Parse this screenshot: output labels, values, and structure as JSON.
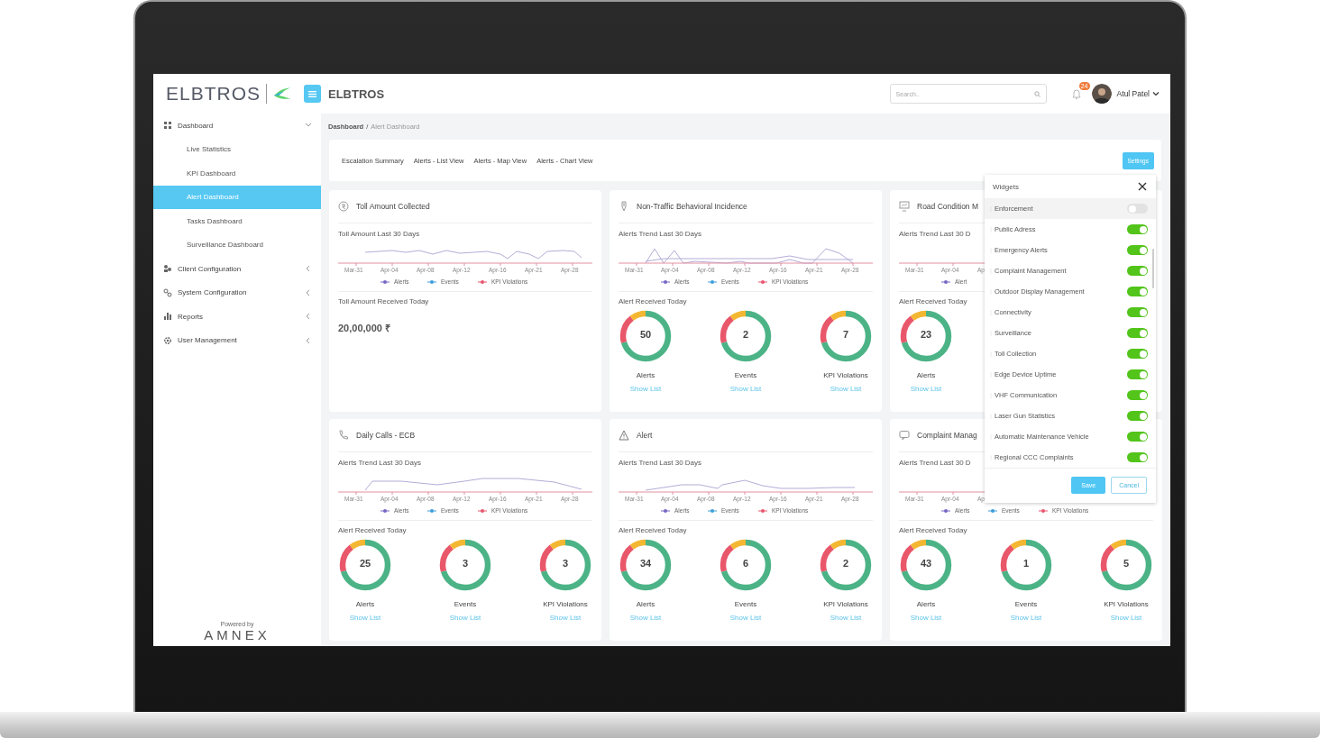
{
  "app": {
    "logo": "ELBTROS",
    "title": "ELBTROS"
  },
  "search": {
    "placeholder": "Search.."
  },
  "notifications": {
    "count": "24"
  },
  "user": {
    "name": "Atul Patel"
  },
  "sidebar": {
    "items": [
      {
        "label": "Dashboard",
        "expanded": true,
        "children": [
          {
            "label": "Live Statistics",
            "selected": false
          },
          {
            "label": "KPI Dashboard",
            "selected": false
          },
          {
            "label": "Alert Dashboard",
            "selected": true
          },
          {
            "label": "Tasks Dashboard",
            "selected": false
          },
          {
            "label": "Surveillance Dashboard",
            "selected": false
          }
        ]
      },
      {
        "label": "Client Configuration",
        "expanded": false
      },
      {
        "label": "System Configuration",
        "expanded": false
      },
      {
        "label": "Reports",
        "expanded": false
      },
      {
        "label": "User Management",
        "expanded": false
      }
    ]
  },
  "footer": {
    "caption": "Powered by",
    "brand": "AMNEX"
  },
  "breadcrumb": {
    "items": [
      "Dashboard",
      "Alert Dashboard"
    ],
    "separator": "/"
  },
  "tabs": [
    "Escalation Summary",
    "Alerts - List View",
    "Alerts - Map View",
    "Alerts - Chart View"
  ],
  "settings_button": "Settings",
  "cards": [
    {
      "title": "Toll Amount Collected",
      "trend_title": "Toll Amount Last 30 Days",
      "x_labels": [
        "Mar-31",
        "Apr-04",
        "Apr-08",
        "Apr-12",
        "Apr-16",
        "Apr-21",
        "Apr-28"
      ],
      "legend": [
        {
          "label": "Alerts",
          "color": "#7468c4"
        },
        {
          "label": "Events",
          "color": "#3d9fdc"
        },
        {
          "label": "KPI Violations",
          "color": "#e8566e"
        }
      ],
      "summary_title": "Toll Amount Received Today",
      "amount": "20,00,000 ₹"
    },
    {
      "title": "Non-Traffic Behavioral Incidence",
      "trend_title": "Alerts Trend Last 30 Days",
      "x_labels": [
        "Mar-31",
        "Apr-04",
        "Apr-08",
        "Apr-12",
        "Apr-16",
        "Apr-21",
        "Apr-28"
      ],
      "legend": [
        {
          "label": "Alerts",
          "color": "#7468c4"
        },
        {
          "label": "Events",
          "color": "#3d9fdc"
        },
        {
          "label": "KPI Violations",
          "color": "#e8566e"
        }
      ],
      "summary_title": "Alert Received Today",
      "counts": [
        {
          "value": "50",
          "label": "Alerts",
          "link": "Show List"
        },
        {
          "value": "2",
          "label": "Events",
          "link": "Show List"
        },
        {
          "value": "7",
          "label": "KPI Violations",
          "link": "Show List"
        }
      ]
    },
    {
      "title": "Road Condition M",
      "trend_title": "Alerts Trend Last 30 D",
      "x_labels": [
        "Mar-31",
        "Apr-04",
        "Ap"
      ],
      "legend": [
        {
          "label": "Alert",
          "color": "#7468c4"
        }
      ],
      "summary_title": "Alert Received Today",
      "counts": [
        {
          "value": "23",
          "label": "Alerts",
          "link": "Show List"
        }
      ]
    },
    {
      "title": "Daily Calls - ECB",
      "trend_title": "Alerts Trend Last 30 Days",
      "x_labels": [
        "Mar-31",
        "Apr-04",
        "Apr-08",
        "Apr-12",
        "Apr-16",
        "Apr-21",
        "Apr-28"
      ],
      "legend": [
        {
          "label": "Alerts",
          "color": "#7468c4"
        },
        {
          "label": "Events",
          "color": "#3d9fdc"
        },
        {
          "label": "KPI Violations",
          "color": "#e8566e"
        }
      ],
      "summary_title": "Alert Received Today",
      "counts": [
        {
          "value": "25",
          "label": "Alerts",
          "link": "Show List"
        },
        {
          "value": "3",
          "label": "Events",
          "link": "Show List"
        },
        {
          "value": "3",
          "label": "KPI Violations",
          "link": "Show List"
        }
      ]
    },
    {
      "title": "Alert",
      "trend_title": "Alerts Trend Last 30 Days",
      "x_labels": [
        "Mar-31",
        "Apr-04",
        "Apr-08",
        "Apr-12",
        "Apr-16",
        "Apr-21",
        "Apr-28"
      ],
      "legend": [
        {
          "label": "Alerts",
          "color": "#7468c4"
        },
        {
          "label": "Events",
          "color": "#3d9fdc"
        },
        {
          "label": "KPI Violations",
          "color": "#e8566e"
        }
      ],
      "summary_title": "Alert Received Today",
      "counts": [
        {
          "value": "34",
          "label": "Alerts",
          "link": "Show List"
        },
        {
          "value": "6",
          "label": "Events",
          "link": "Show List"
        },
        {
          "value": "2",
          "label": "KPI Violations",
          "link": "Show List"
        }
      ]
    },
    {
      "title": "Complaint Manag",
      "trend_title": "Alerts Trend Last 30 D",
      "x_labels": [
        "Mar-31",
        "Apr-04",
        "Ap"
      ],
      "legend": [
        {
          "label": "Alerts",
          "color": "#7468c4"
        },
        {
          "label": "Events",
          "color": "#3d9fdc"
        },
        {
          "label": "KPI Violations",
          "color": "#e8566e"
        }
      ],
      "summary_title": "Alert Received Today",
      "counts": [
        {
          "value": "43",
          "label": "Alerts",
          "link": "Show List"
        },
        {
          "value": "1",
          "label": "Events",
          "link": "Show List"
        },
        {
          "value": "5",
          "label": "KPI Violations",
          "link": "Show List"
        }
      ]
    }
  ],
  "widgets_panel": {
    "title": "Widgets",
    "items": [
      {
        "label": "Enforcement",
        "on": false,
        "highlighted": true
      },
      {
        "label": "Public Adress",
        "on": true,
        "highlighted": false
      },
      {
        "label": "Emergency Alerts",
        "on": true,
        "highlighted": false
      },
      {
        "label": "Complaint Management",
        "on": true,
        "highlighted": false
      },
      {
        "label": "Outdoor Display Management",
        "on": true,
        "highlighted": false
      },
      {
        "label": "Connectivity",
        "on": true,
        "highlighted": false
      },
      {
        "label": "Surveillance",
        "on": true,
        "highlighted": false
      },
      {
        "label": "Toll Collection",
        "on": true,
        "highlighted": false
      },
      {
        "label": "Edge Device Uptime",
        "on": true,
        "highlighted": false
      },
      {
        "label": "VHF Communication",
        "on": true,
        "highlighted": false
      },
      {
        "label": "Laser Gun Statistics",
        "on": true,
        "highlighted": false
      },
      {
        "label": "Automatic Maintenance Vehicle",
        "on": true,
        "highlighted": false
      },
      {
        "label": "Regional CCC Complaints",
        "on": true,
        "highlighted": false
      }
    ],
    "save": "Save",
    "cancel": "Cancel"
  }
}
